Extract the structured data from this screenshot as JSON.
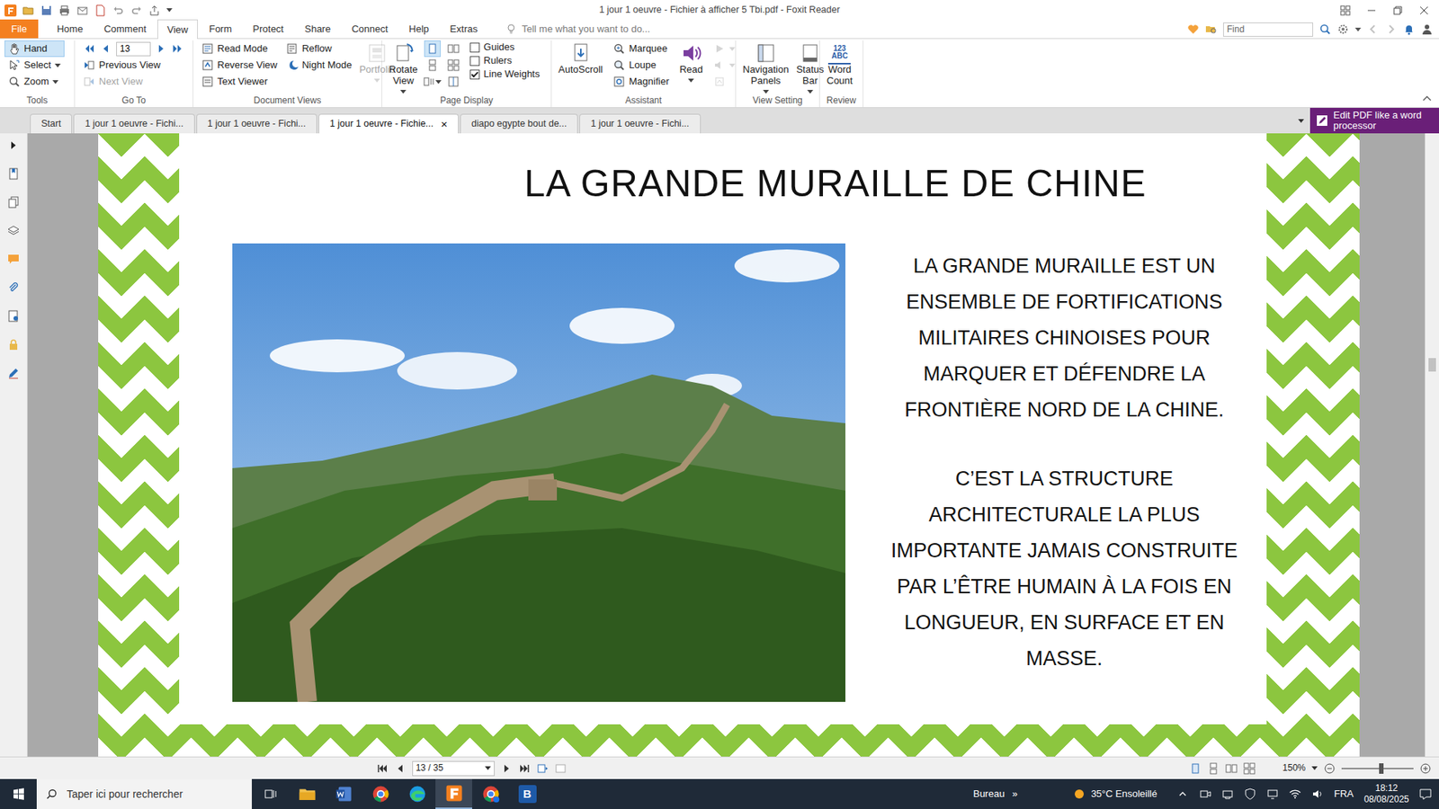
{
  "window": {
    "title": "1 jour 1 oeuvre - Fichier à afficher 5  Tbi.pdf - Foxit Reader"
  },
  "menu": {
    "tabs": [
      {
        "label": "File",
        "selected": false
      },
      {
        "label": "Home",
        "selected": false
      },
      {
        "label": "Comment",
        "selected": false
      },
      {
        "label": "View",
        "selected": true
      },
      {
        "label": "Form",
        "selected": false
      },
      {
        "label": "Protect",
        "selected": false
      },
      {
        "label": "Share",
        "selected": false
      },
      {
        "label": "Connect",
        "selected": false
      },
      {
        "label": "Help",
        "selected": false
      },
      {
        "label": "Extras",
        "selected": false
      }
    ],
    "tell_me": "Tell me what you want to do...",
    "find_placeholder": "Find"
  },
  "ribbon": {
    "tools": {
      "label": "Tools",
      "items": [
        {
          "label": "Hand",
          "selected": true
        },
        {
          "label": "Select",
          "selected": false
        },
        {
          "label": "Zoom",
          "selected": false
        }
      ]
    },
    "go_to": {
      "label": "Go To",
      "page": "13",
      "items": [
        {
          "label": "Previous View",
          "disabled": false
        },
        {
          "label": "Next View",
          "disabled": true
        }
      ]
    },
    "document_views": {
      "label": "Document Views",
      "items": [
        {
          "label": "Read Mode",
          "disabled": false
        },
        {
          "label": "Reverse View",
          "disabled": false
        },
        {
          "label": "Text Viewer",
          "disabled": false
        },
        {
          "label": "Reflow",
          "disabled": false
        },
        {
          "label": "Night Mode",
          "disabled": false
        },
        {
          "label": "Portfolio",
          "disabled": true
        }
      ]
    },
    "page_display": {
      "label": "Page Display",
      "rotate": "Rotate View",
      "layout_buttons": [
        {
          "selected": true
        },
        {
          "selected": false
        },
        {
          "selected": false
        },
        {
          "selected": false
        },
        {
          "selected": false
        },
        {
          "selected": false
        }
      ],
      "checks": [
        {
          "label": "Guides",
          "checked": false
        },
        {
          "label": "Rulers",
          "checked": false
        },
        {
          "label": "Line Weights",
          "checked": true
        }
      ]
    },
    "assistant": {
      "label": "Assistant",
      "items": [
        {
          "label": "AutoScroll"
        },
        {
          "label": "Marquee"
        },
        {
          "label": "Loupe"
        },
        {
          "label": "Magnifier"
        },
        {
          "label": "Read"
        }
      ],
      "read_controls": [
        {
          "disabled": true
        },
        {
          "disabled": true
        },
        {
          "disabled": true
        }
      ]
    },
    "view_setting": {
      "label": "View Setting",
      "items": [
        {
          "label": "Navigation Panels"
        },
        {
          "label": "Status Bar"
        }
      ]
    },
    "review": {
      "label": "Review",
      "badge_top": "123",
      "badge_bottom": "ABC",
      "items": [
        {
          "label": "Word Count"
        }
      ]
    }
  },
  "doc_tabs": [
    {
      "label": "Start",
      "selected": false
    },
    {
      "label": "1 jour 1 oeuvre - Fichi...",
      "selected": false
    },
    {
      "label": "1 jour 1 oeuvre - Fichi...",
      "selected": false
    },
    {
      "label": "1 jour 1 oeuvre - Fichie...",
      "selected": true,
      "close": "×"
    },
    {
      "label": "diapo egypte bout de...",
      "selected": false
    },
    {
      "label": "1 jour 1 oeuvre - Fichi...",
      "selected": false
    }
  ],
  "banner": "Edit PDF like a word processor",
  "document": {
    "title": "LA GRANDE MURAILLE DE CHINE",
    "paragraphs": [
      "LA GRANDE MURAILLE EST UN ENSEMBLE DE FORTIFICATIONS MILITAIRES CHINOISES POUR MARQUER ET DÉFENDRE LA FRONTIÈRE NORD DE LA CHINE.",
      "C’EST LA STRUCTURE ARCHITECTURALE LA PLUS IMPORTANTE JAMAIS CONSTRUITE PAR L’ÊTRE HUMAIN À LA FOIS EN LONGUEUR, EN SURFACE ET EN MASSE."
    ]
  },
  "status_bar": {
    "page": "13 / 35",
    "zoom": "150%",
    "zoom_slider": {
      "level": 0.55
    }
  },
  "taskbar": {
    "search_placeholder": "Taper ici pour rechercher",
    "app_letter": "B",
    "desktop": "Bureau",
    "chevron": "»",
    "weather": "35°C Ensoleillé",
    "language": "FRA",
    "time": "18:12",
    "date": "08/08/2025"
  }
}
